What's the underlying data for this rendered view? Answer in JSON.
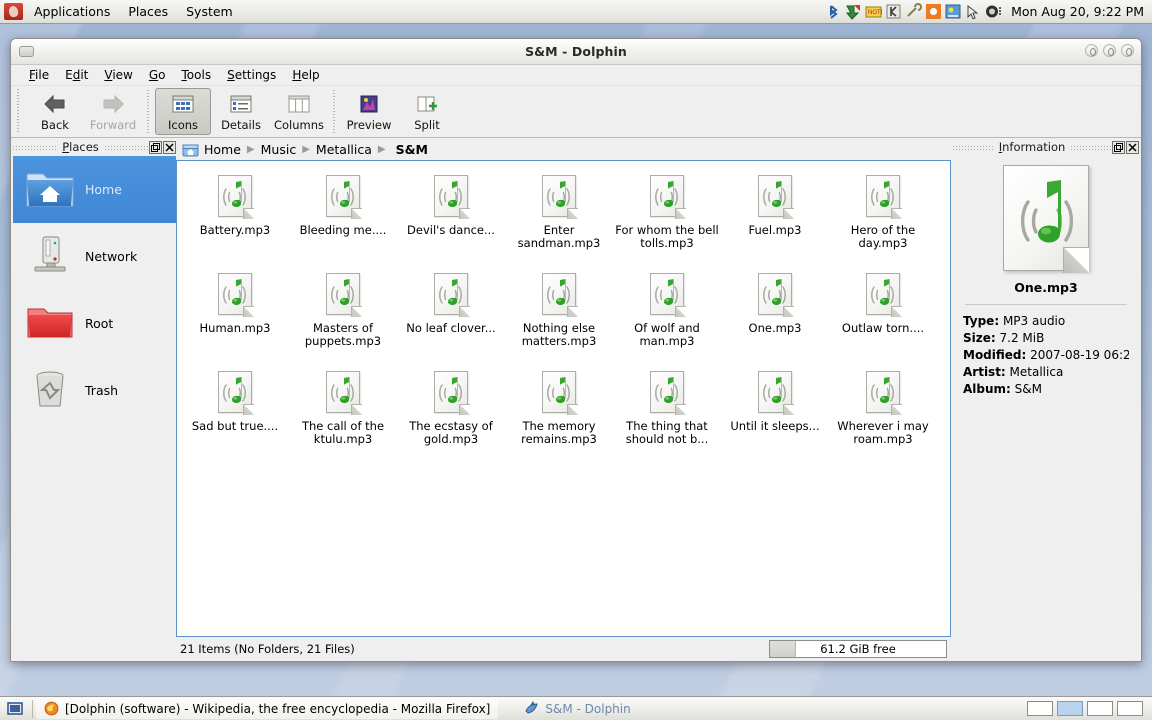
{
  "top_panel": {
    "logo_icon": "gnome-foot-icon",
    "menus": [
      {
        "label": "Applications",
        "name": "applications-menu"
      },
      {
        "label": "Places",
        "name": "places-menu"
      },
      {
        "label": "System",
        "name": "system-menu"
      }
    ],
    "tray_icons": [
      "bluetooth-icon",
      "update-manager-icon",
      "notes-icon",
      "kde-icon",
      "tools-icon",
      "brightness-icon",
      "network-settings-icon",
      "mouse-icon",
      "display-settings-icon"
    ],
    "clock": "Mon Aug 20,  9:22 PM"
  },
  "window": {
    "title": "S&M - Dolphin",
    "menubar": [
      {
        "label": "File",
        "accel": "F"
      },
      {
        "label": "Edit",
        "accel": "E"
      },
      {
        "label": "View",
        "accel": "V"
      },
      {
        "label": "Go",
        "accel": "G"
      },
      {
        "label": "Tools",
        "accel": "T"
      },
      {
        "label": "Settings",
        "accel": "S"
      },
      {
        "label": "Help",
        "accel": "H"
      }
    ],
    "toolbar": [
      {
        "label": "Back",
        "icon": "back-arrow-icon",
        "state": "enabled"
      },
      {
        "label": "Forward",
        "icon": "forward-arrow-icon",
        "state": "disabled"
      },
      {
        "label": "Icons",
        "icon": "icons-view-icon",
        "state": "active"
      },
      {
        "label": "Details",
        "icon": "details-view-icon",
        "state": "enabled"
      },
      {
        "label": "Columns",
        "icon": "columns-view-icon",
        "state": "enabled"
      },
      {
        "label": "Preview",
        "icon": "preview-icon",
        "state": "enabled"
      },
      {
        "label": "Split",
        "icon": "split-view-icon",
        "state": "enabled"
      }
    ],
    "window_buttons": [
      "minimize-button",
      "maximize-button",
      "close-button"
    ]
  },
  "places": {
    "title": "Places",
    "title_accel": "P",
    "undock_label": "❐",
    "close_label": "✕",
    "items": [
      {
        "label": "Home",
        "icon": "home-folder-icon",
        "selected": true
      },
      {
        "label": "Network",
        "icon": "network-icon",
        "selected": false
      },
      {
        "label": "Root",
        "icon": "root-folder-icon",
        "selected": false
      },
      {
        "label": "Trash",
        "icon": "trash-icon",
        "selected": false
      }
    ]
  },
  "breadcrumb": {
    "home_icon": "home-icon",
    "crumbs": [
      "Home",
      "Music",
      "Metallica",
      "S&M"
    ],
    "current_index": 3,
    "separator": "▶"
  },
  "files": [
    {
      "name": "Battery.mp3",
      "icon": "mp3-file-icon"
    },
    {
      "name": "Bleeding me....",
      "icon": "mp3-file-icon"
    },
    {
      "name": "Devil's dance...",
      "icon": "mp3-file-icon"
    },
    {
      "name": "Enter sandman.mp3",
      "icon": "mp3-file-icon"
    },
    {
      "name": "For whom the bell tolls.mp3",
      "icon": "mp3-file-icon"
    },
    {
      "name": "Fuel.mp3",
      "icon": "mp3-file-icon"
    },
    {
      "name": "Hero of the day.mp3",
      "icon": "mp3-file-icon"
    },
    {
      "name": "Human.mp3",
      "icon": "mp3-file-icon"
    },
    {
      "name": "Masters of puppets.mp3",
      "icon": "mp3-file-icon"
    },
    {
      "name": "No leaf clover...",
      "icon": "mp3-file-icon"
    },
    {
      "name": "Nothing else matters.mp3",
      "icon": "mp3-file-icon"
    },
    {
      "name": "Of wolf and man.mp3",
      "icon": "mp3-file-icon"
    },
    {
      "name": "One.mp3",
      "icon": "mp3-file-icon"
    },
    {
      "name": "Outlaw torn....",
      "icon": "mp3-file-icon"
    },
    {
      "name": "Sad but true....",
      "icon": "mp3-file-icon"
    },
    {
      "name": "The call of the ktulu.mp3",
      "icon": "mp3-file-icon"
    },
    {
      "name": "The ecstasy of gold.mp3",
      "icon": "mp3-file-icon"
    },
    {
      "name": "The memory remains.mp3",
      "icon": "mp3-file-icon"
    },
    {
      "name": "The thing that should not b...",
      "icon": "mp3-file-icon"
    },
    {
      "name": "Until it sleeps...",
      "icon": "mp3-file-icon"
    },
    {
      "name": "Wherever i may roam.mp3",
      "icon": "mp3-file-icon"
    }
  ],
  "statusbar": {
    "text": "21 Items (No Folders, 21 Files)",
    "free_space": "61.2 GiB free"
  },
  "info": {
    "title": "Information",
    "title_accel": "I",
    "undock_label": "❐",
    "close_label": "✕",
    "icon": "mp3-file-icon",
    "filename": "One.mp3",
    "meta": [
      {
        "key": "Type:",
        "value": "MP3 audio"
      },
      {
        "key": "Size:",
        "value": "7.2 MiB"
      },
      {
        "key": "Modified:",
        "value": "2007-08-19 06:2·"
      },
      {
        "key": "Artist:",
        "value": "Metallica"
      },
      {
        "key": "Album:",
        "value": "S&M"
      }
    ]
  },
  "taskbar": {
    "show_desktop_icon": "show-desktop-icon",
    "tasks": [
      {
        "label": "[Dolphin (software) - Wikipedia, the free encyclopedia - Mozilla Firefox]",
        "icon": "firefox-icon",
        "active": true
      },
      {
        "label": "S&M - Dolphin",
        "icon": "dolphin-icon",
        "active": false
      }
    ],
    "workspaces": [
      {
        "name": "workspace-1",
        "current": false
      },
      {
        "name": "workspace-2",
        "current": true
      },
      {
        "name": "workspace-3",
        "current": false
      },
      {
        "name": "workspace-4",
        "current": false
      }
    ]
  },
  "colors": {
    "selection_blue": "#4d94de",
    "view_border": "#5a91c8",
    "note_green": "#2bA02b",
    "panel_bg": "#efefef"
  }
}
